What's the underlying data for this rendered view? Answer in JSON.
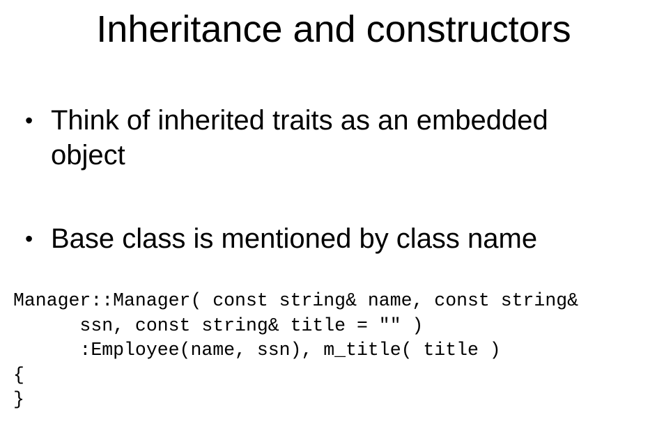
{
  "slide": {
    "title": "Inheritance and constructors",
    "bullets": [
      {
        "marker": "•",
        "text": "Think of inherited traits as an embedded object"
      },
      {
        "marker": "•",
        "text": "Base class is mentioned by class name"
      }
    ],
    "code_lines": [
      "Manager::Manager( const string& name, const string&",
      "      ssn, const string& title = \"\" )",
      "      :Employee(name, ssn), m_title( title )",
      "{",
      "}"
    ]
  }
}
